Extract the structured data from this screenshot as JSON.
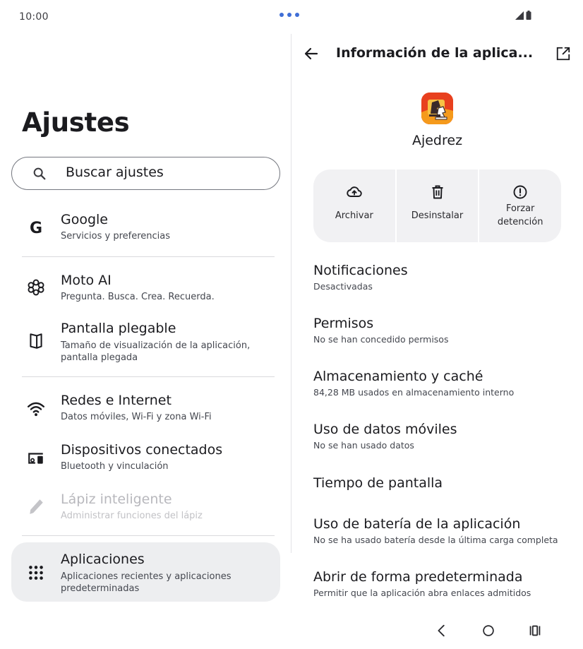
{
  "status": {
    "time": "10:00"
  },
  "left": {
    "title": "Ajustes",
    "search_placeholder": "Buscar ajustes",
    "items": [
      {
        "title": "Google",
        "sub": "Servicios y preferencias",
        "icon": "google-icon"
      },
      {
        "title": "Moto AI",
        "sub": "Pregunta. Busca. Crea. Recuerda.",
        "icon": "moto-ai-icon"
      },
      {
        "title": "Pantalla plegable",
        "sub": "Tamaño de visualización de la aplicación, pantalla plegada",
        "icon": "foldable-screen-icon"
      },
      {
        "title": "Redes e Internet",
        "sub": "Datos móviles, Wi-Fi y zona Wi-Fi",
        "icon": "wifi-icon"
      },
      {
        "title": "Dispositivos conectados",
        "sub": "Bluetooth y vinculación",
        "icon": "devices-icon"
      },
      {
        "title": "Lápiz inteligente",
        "sub": "Administrar funciones del lápiz",
        "icon": "pen-icon"
      },
      {
        "title": "Aplicaciones",
        "sub": "Aplicaciones recientes y aplicaciones predeterminadas",
        "icon": "apps-grid-icon"
      }
    ]
  },
  "right": {
    "title": "Información de la aplica...",
    "app_name": "Ajedrez",
    "actions": [
      {
        "label": "Archivar",
        "icon": "cloud-upload-icon"
      },
      {
        "label": "Desinstalar",
        "icon": "trash-icon"
      },
      {
        "label": "Forzar detención",
        "icon": "alert-circle-icon"
      }
    ],
    "items": [
      {
        "title": "Notificaciones",
        "sub": "Desactivadas"
      },
      {
        "title": "Permisos",
        "sub": "No se han concedido permisos"
      },
      {
        "title": "Almacenamiento y caché",
        "sub": "84,28 MB usados en almacenamiento interno"
      },
      {
        "title": "Uso de datos móviles",
        "sub": "No se han usado datos"
      },
      {
        "title": "Tiempo de pantalla",
        "sub": ""
      },
      {
        "title": "Uso de batería de la aplicación",
        "sub": "No se ha usado batería desde la última carga completa"
      },
      {
        "title": "Abrir de forma predeterminada",
        "sub": "Permitir que la aplicación abra enlaces admitidos"
      }
    ]
  },
  "colors": {
    "accent_dots": "#3f6ed6",
    "selected_bg": "#edeef0",
    "app_icon_bg": "#e8401e"
  }
}
